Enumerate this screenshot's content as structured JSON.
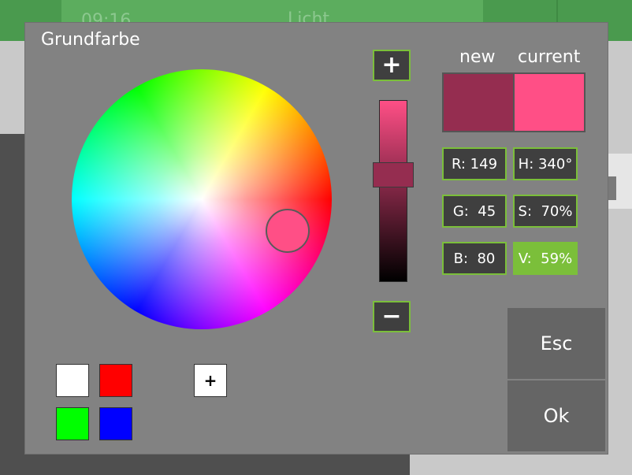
{
  "background": {
    "clock": "09:16",
    "title": "Licht"
  },
  "dialog": {
    "title": "Grundfarbe",
    "wheel_cursor_color": "#ff4f86",
    "brightness_increase_label": "+",
    "brightness_decrease_label": "−",
    "brightness_level": 0.59,
    "compare": {
      "new_label": "new",
      "current_label": "current",
      "new_color": "#952d50",
      "current_color": "#ff4f86"
    },
    "values": {
      "r": "R: 149",
      "g": "G:  45",
      "b": "B:  80",
      "h": "H: 340°",
      "s": "S:  70%",
      "v": "V:  59%"
    },
    "active_value": "v",
    "esc_label": "Esc",
    "ok_label": "Ok",
    "presets": [
      "#ffffff",
      "#ff0000",
      "#00ff00",
      "#0000ff"
    ],
    "add_preset_label": "+"
  },
  "colors": {
    "accent": "#7bbf3a",
    "dialog_bg": "#828282",
    "header_green": "#4a9a4e"
  }
}
